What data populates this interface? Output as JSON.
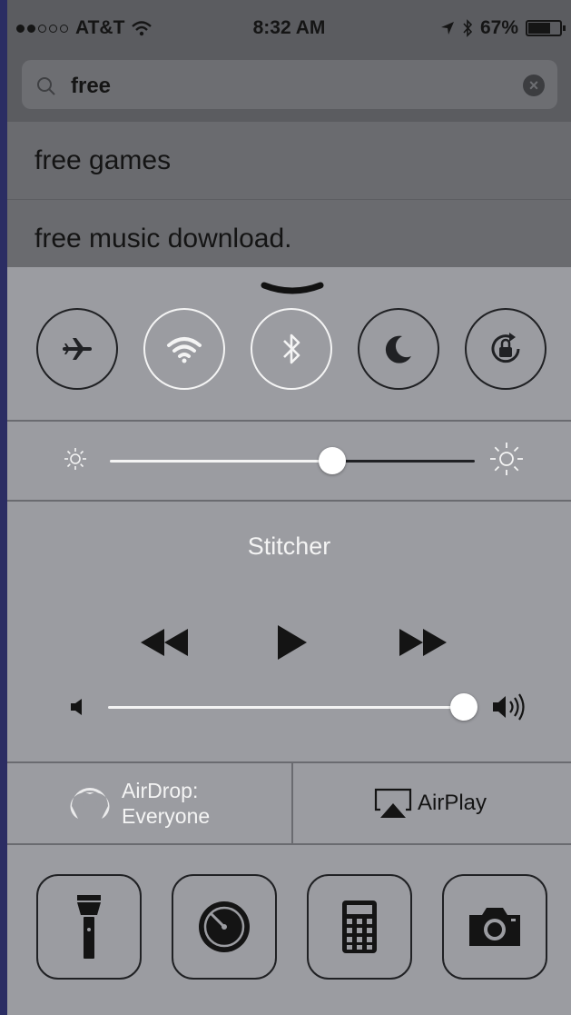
{
  "status_bar": {
    "carrier": "AT&T",
    "time": "8:32 AM",
    "battery": "67%",
    "signal_bars": 2
  },
  "search": {
    "query": "free",
    "suggestions": [
      "free games",
      "free music download."
    ]
  },
  "control_center": {
    "toggles": [
      {
        "name": "airplane-mode",
        "active": false
      },
      {
        "name": "wifi",
        "active": true
      },
      {
        "name": "bluetooth",
        "active": true
      },
      {
        "name": "do-not-disturb",
        "active": false
      },
      {
        "name": "rotation-lock",
        "active": false
      }
    ],
    "brightness_level": 0.61,
    "now_playing": "Stitcher",
    "volume_level": 1.0,
    "airdrop": {
      "line1": "AirDrop:",
      "line2": "Everyone"
    },
    "airplay": {
      "label": "AirPlay"
    },
    "shortcuts": [
      "flashlight",
      "timer",
      "calculator",
      "camera"
    ]
  },
  "colors": {
    "panel": "#9b9ca1",
    "icon_dark": "#202124",
    "active_white": "#f4f4f4"
  }
}
